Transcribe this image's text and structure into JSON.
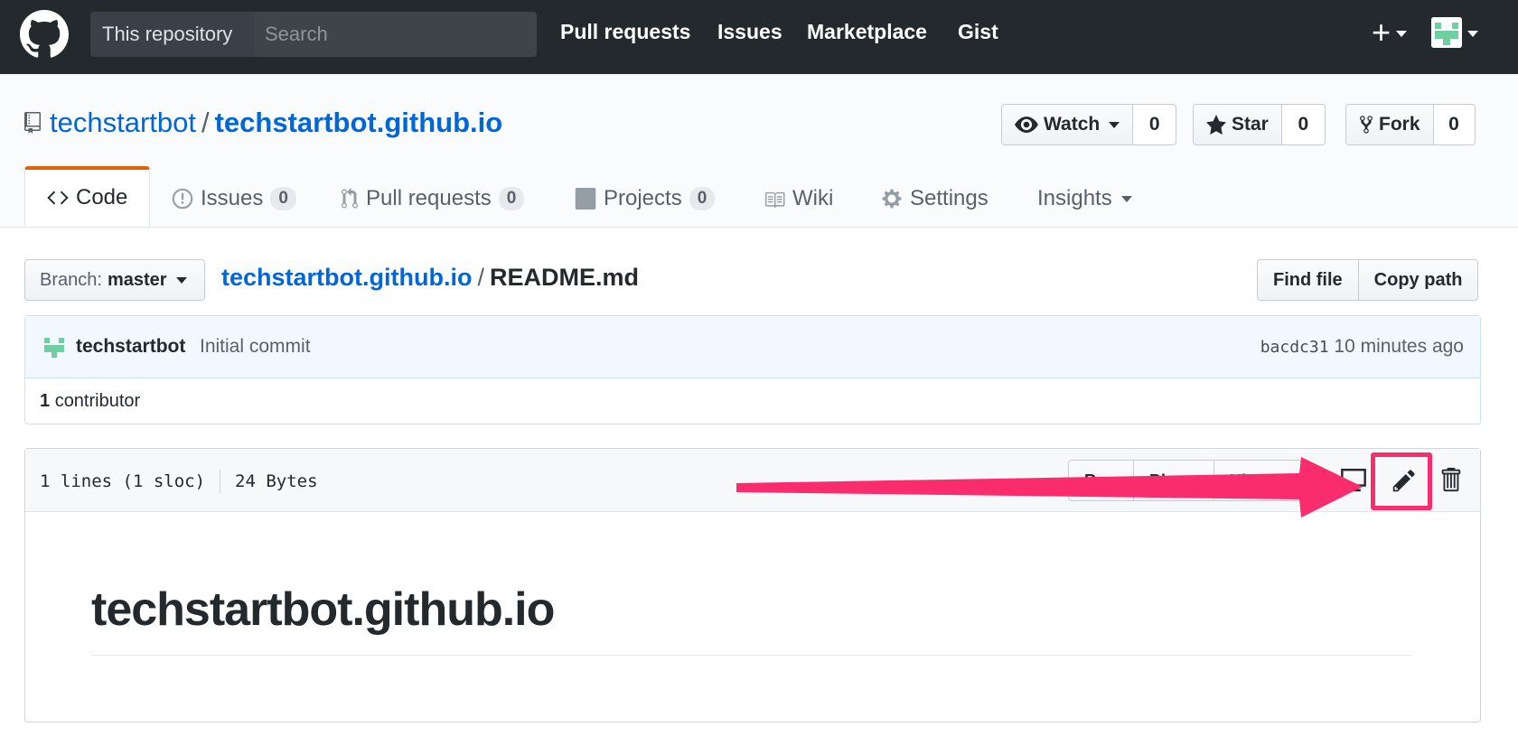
{
  "topnav": {
    "scope_label": "This repository",
    "search_placeholder": "Search",
    "links": [
      "Pull requests",
      "Issues",
      "Marketplace",
      "Gist"
    ],
    "plus_symbol": "+"
  },
  "repo": {
    "owner": "techstartbot",
    "separator": "/",
    "name": "techstartbot.github.io",
    "actions": {
      "watch_label": "Watch",
      "watch_count": "0",
      "star_label": "Star",
      "star_count": "0",
      "fork_label": "Fork",
      "fork_count": "0"
    }
  },
  "tabs": [
    {
      "label": "Code",
      "counter": null,
      "icon": "code-icon",
      "selected": true
    },
    {
      "label": "Issues",
      "counter": "0",
      "icon": "issue-icon"
    },
    {
      "label": "Pull requests",
      "counter": "0",
      "icon": "pull-request-icon"
    },
    {
      "label": "Projects",
      "counter": "0",
      "icon": "project-icon"
    },
    {
      "label": "Wiki",
      "counter": null,
      "icon": "book-icon"
    },
    {
      "label": "Settings",
      "counter": null,
      "icon": "gear-icon"
    },
    {
      "label": "Insights",
      "counter": null,
      "icon": "chevron-down-icon"
    }
  ],
  "filenav": {
    "branch_prefix": "Branch:",
    "branch_name": "master",
    "breadcrumb_repo": "techstartbot.github.io",
    "breadcrumb_sep": "/",
    "breadcrumb_file": "README.md",
    "find_file_label": "Find file",
    "copy_path_label": "Copy path"
  },
  "commit": {
    "author": "techstartbot",
    "message": "Initial commit",
    "sha": "bacdc31",
    "time": "10 minutes ago",
    "contributor_count": "1",
    "contributor_label": "contributor"
  },
  "file": {
    "lines": "1 lines (1 sloc)",
    "size": "24 Bytes",
    "actions": [
      "Raw",
      "Blame",
      "History"
    ],
    "readme_heading": "techstartbot.github.io"
  },
  "colors": {
    "header_bg": "#24292e",
    "link_blue": "#0366d6",
    "tab_accent": "#e36209",
    "annotation_pink": "#f92d6e"
  }
}
